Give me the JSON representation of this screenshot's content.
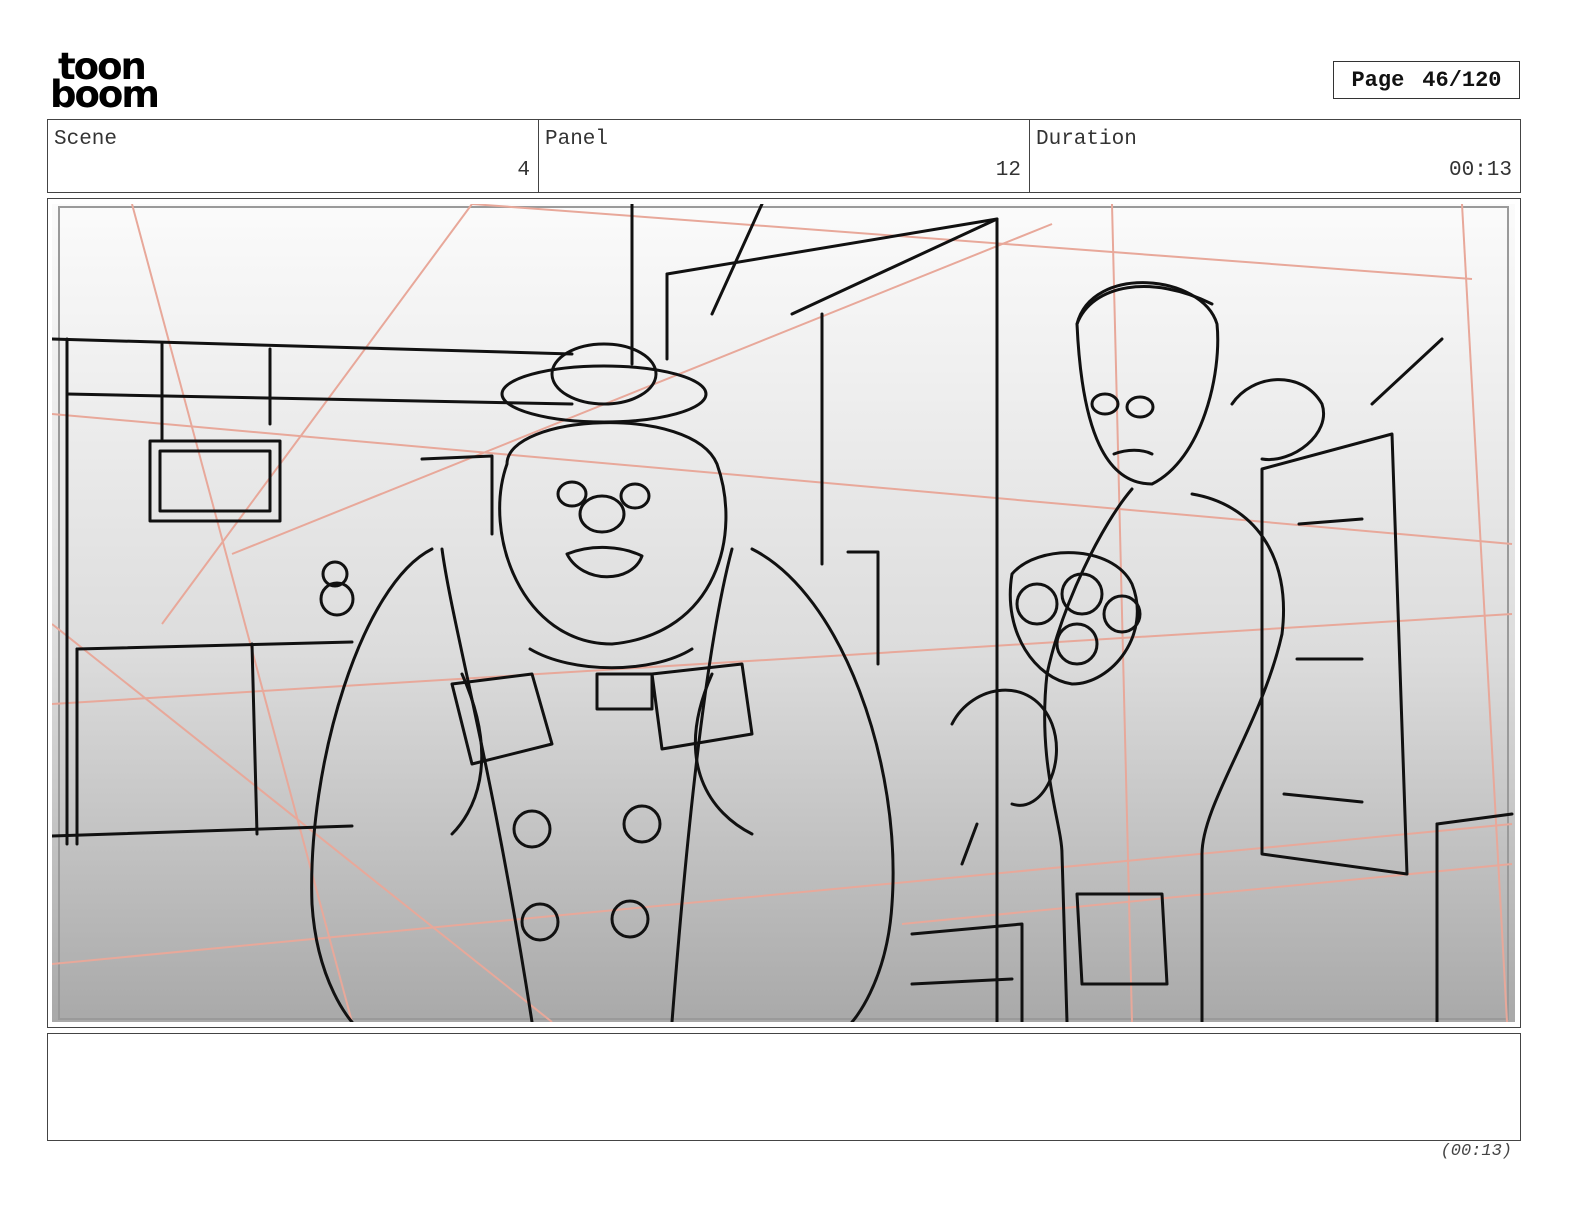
{
  "logo": {
    "line1": "toon",
    "line2": "boom"
  },
  "page": {
    "label": "Page",
    "value": "46/120"
  },
  "meta": {
    "scene_label": "Scene",
    "scene_value": "4",
    "panel_label": "Panel",
    "panel_value": "12",
    "duration_label": "Duration",
    "duration_value": "00:13"
  },
  "panel": {
    "image_icon": "storyboard-sketch",
    "guide_line_color": "#e8a89a",
    "ink_color": "#111111"
  },
  "notes": {
    "text": ""
  },
  "footer": {
    "duration": "(00:13)"
  }
}
